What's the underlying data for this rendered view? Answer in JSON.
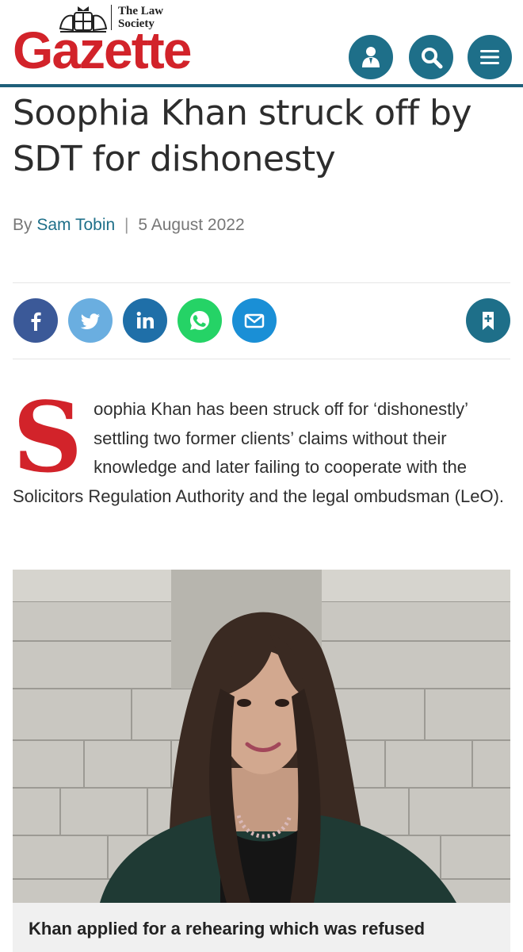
{
  "brand": {
    "society_line1": "The Law",
    "society_line2": "Society",
    "wordmark": "Gazette",
    "accent": "#d2232a",
    "teal": "#1e6f89"
  },
  "header_actions": [
    {
      "icon": "user-icon"
    },
    {
      "icon": "search-icon"
    },
    {
      "icon": "menu-icon"
    }
  ],
  "article": {
    "headline": "Soophia Khan struck off by SDT for dishonesty",
    "by_prefix": "By",
    "author": "Sam Tobin",
    "separator": "|",
    "date": "5 August 2022",
    "dropcap": "S",
    "lead_rest": "oophia Khan has been struck off for ‘dishonestly’ settling two former clients’ claims without their knowledge and later failing to cooperate with the Solicitors Regulation Authority and the legal ombudsman (LeO).",
    "caption": "Khan applied for a rehearing which was refused"
  },
  "share": [
    {
      "icon": "facebook-icon",
      "color": "#3b5998"
    },
    {
      "icon": "twitter-icon",
      "color": "#6aaee0"
    },
    {
      "icon": "linkedin-icon",
      "color": "#1f6fa8"
    },
    {
      "icon": "whatsapp-icon",
      "color": "#25d366"
    },
    {
      "icon": "email-icon",
      "color": "#1a8fd6"
    }
  ],
  "bookmark": {
    "icon": "bookmark-add-icon",
    "color": "#1e6f89"
  }
}
